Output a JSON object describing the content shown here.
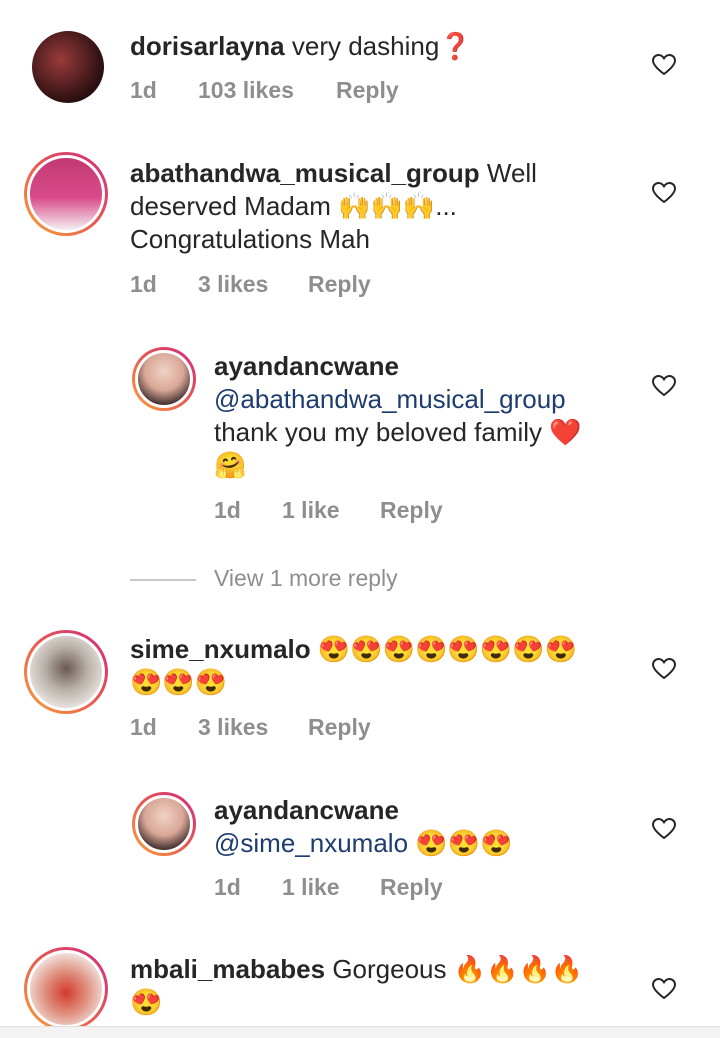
{
  "comments": [
    {
      "user": "dorisarlayna",
      "text": " very dashing❓",
      "time": "1d",
      "likes": "103 likes",
      "reply": "Reply"
    },
    {
      "user": "abathandwa_musical_group",
      "text_line1": " Well",
      "text_line2": "deserved Madam 🙌🙌🙌...",
      "text_line3": "Congratulations Mah",
      "time": "1d",
      "likes": "3 likes",
      "reply": "Reply"
    },
    {
      "user": "ayandancwane",
      "mention": "@abathandwa_musical_group",
      "text_line1": "thank you my beloved family ❤️",
      "text_line2": "🤗",
      "time": "1d",
      "likes": "1 like",
      "reply": "Reply"
    },
    {
      "user": "sime_nxumalo",
      "text_line1": " 😍😍😍😍😍😍😍😍",
      "text_line2": "😍😍😍",
      "time": "1d",
      "likes": "3 likes",
      "reply": "Reply"
    },
    {
      "user": "ayandancwane",
      "mention": "@sime_nxumalo",
      "text_line1": " 😍😍😍",
      "time": "1d",
      "likes": "1 like",
      "reply": "Reply"
    },
    {
      "user": "mbali_mababes",
      "text_line1": " Gorgeous 🔥🔥🔥🔥",
      "text_line2": "😍"
    }
  ],
  "view_more": "View 1 more reply",
  "colors": {
    "text": "#262626",
    "meta": "#8e8e8e",
    "mention": "#1e3c6e",
    "ring_start": "#f9a23a",
    "ring_end": "#cd2b82"
  },
  "icons": [
    "heart-outline-icon"
  ]
}
